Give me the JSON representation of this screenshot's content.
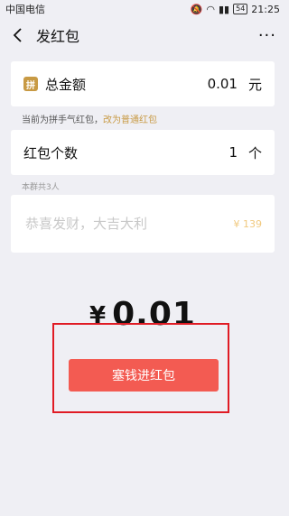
{
  "status": {
    "carrier": "中国电信",
    "time": "21:25",
    "battery": "54"
  },
  "header": {
    "title": "发红包"
  },
  "total": {
    "label": "总金额",
    "value": "0.01",
    "unit": "元"
  },
  "hint": {
    "prefix": "当前为拼手气红包，",
    "link": "改为普通红包"
  },
  "count": {
    "label": "红包个数",
    "value": "1",
    "unit": "个"
  },
  "group_hint": "本群共3人",
  "message": {
    "placeholder": "恭喜发财，大吉大利",
    "price": "¥ 139"
  },
  "amount": {
    "symbol": "¥",
    "value": "0.01"
  },
  "submit": {
    "label": "塞钱进红包"
  },
  "colors": {
    "accent": "#f35b52",
    "gold": "#c89a44",
    "highlight": "#e01b24"
  }
}
